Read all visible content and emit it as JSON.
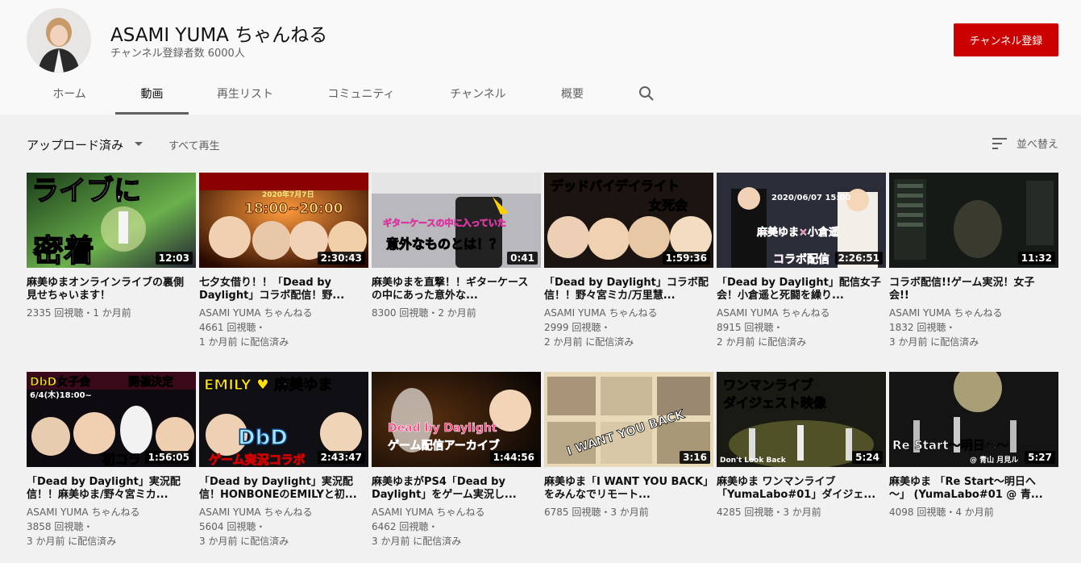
{
  "channel": {
    "name": "ASAMI YUMA ちゃんねる",
    "subscribers": "チャンネル登録者数 6000人",
    "subscribe_label": "チャンネル登録"
  },
  "tabs": [
    {
      "label": "ホーム",
      "active": false
    },
    {
      "label": "動画",
      "active": true
    },
    {
      "label": "再生リスト",
      "active": false
    },
    {
      "label": "コミュニティ",
      "active": false
    },
    {
      "label": "チャンネル",
      "active": false
    },
    {
      "label": "概要",
      "active": false
    }
  ],
  "toolbar": {
    "filter_label": "アップロード済み",
    "play_all": "すべて再生",
    "sort_label": "並べ替え"
  },
  "videos": [
    {
      "title": "麻美ゆまオンラインライブの裏側見せちゃいます！",
      "meta1": "2335 回視聴・1 か月前",
      "meta2": "",
      "meta3": "",
      "duration": "12:03",
      "thumb_text": [
        "ライブに",
        "密着"
      ]
    },
    {
      "title": "七夕女借り！！「Dead by Daylight」コラボ配信！野...",
      "meta1": "ASAMI YUMA ちゃんねる",
      "meta2": "4661 回視聴・",
      "meta3": "1 か月前 に配信済み",
      "duration": "2:30:43",
      "thumb_text": [
        "2020年7月7日",
        "18:00~20:00"
      ]
    },
    {
      "title": "麻美ゆまを直撃！！ギターケースの中にあった意外な...",
      "meta1": "8300 回視聴・2 か月前",
      "meta2": "",
      "meta3": "",
      "duration": "0:41",
      "thumb_text": [
        "ギターケースの中に入っていた",
        "意外なものとは！？"
      ]
    },
    {
      "title": "「Dead by Daylight」コラボ配信！！野々宮ミカ/万里慧...",
      "meta1": "ASAMI YUMA ちゃんねる",
      "meta2": "2999 回視聴・",
      "meta3": "2 か月前 に配信済み",
      "duration": "1:59:36",
      "thumb_text": [
        "デッドバイデイライト",
        "女死会"
      ]
    },
    {
      "title": "「Dead by Daylight」配信女子会！小倉遥と死闘を繰り...",
      "meta1": "ASAMI YUMA ちゃんねる",
      "meta2": "8915 回視聴・",
      "meta3": "2 か月前 に配信済み",
      "duration": "2:26:51",
      "thumb_text": [
        "2020/06/07 15:00",
        "麻美ゆま×小倉遥",
        "コラボ配信"
      ]
    },
    {
      "title": "コラボ配信!!ゲーム実況！女子会!!",
      "meta1": "ASAMI YUMA ちゃんねる",
      "meta2": "1832 回視聴・",
      "meta3": "3 か月前 に配信済み",
      "duration": "11:32",
      "thumb_text": []
    },
    {
      "title": "「Dead by Daylight」実況配信！！麻美ゆま/野々宮ミカ...",
      "meta1": "ASAMI YUMA ちゃんねる",
      "meta2": "3858 回視聴・",
      "meta3": "3 か月前 に配信済み",
      "duration": "1:56:05",
      "thumb_text": [
        "DbD女子会",
        "開催決定",
        "6/4(木)18:00~",
        "初コラ"
      ]
    },
    {
      "title": "「Dead by Daylight」実況配信！HONBONEのEMILYと初...",
      "meta1": "ASAMI YUMA ちゃんねる",
      "meta2": "5604 回視聴・",
      "meta3": "3 か月前 に配信済み",
      "duration": "2:43:47",
      "thumb_text": [
        "EMILY ♥ 麻美ゆま",
        "DbD",
        "ゲーム実況コラボ"
      ]
    },
    {
      "title": "麻美ゆまがPS4「Dead by Daylight」をゲーム実況し...",
      "meta1": "ASAMI YUMA ちゃんねる",
      "meta2": "6462 回視聴・",
      "meta3": "3 か月前 に配信済み",
      "duration": "1:44:56",
      "thumb_text": [
        "Dead by Daylight",
        "ゲーム配信アーカイブ"
      ]
    },
    {
      "title": "麻美ゆま「I WANT YOU BACK」をみんなでリモート...",
      "meta1": "6785 回視聴・3 か月前",
      "meta2": "",
      "meta3": "",
      "duration": "3:16",
      "thumb_text": [
        "I WANT YOU BACK"
      ]
    },
    {
      "title": "麻美ゆま ワンマンライブ「YumaLabo#01」ダイジェ...",
      "meta1": "4285 回視聴・3 か月前",
      "meta2": "",
      "meta3": "",
      "duration": "5:24",
      "thumb_text": [
        "ワンマンライブ",
        "ダイジェスト映像",
        "Don't Look Back"
      ]
    },
    {
      "title": "麻美ゆま 「Re Start～明日へ～」 (YumaLabo#01 @ 青...",
      "meta1": "4098 回視聴・4 か月前",
      "meta2": "",
      "meta3": "",
      "duration": "5:27",
      "thumb_text": [
        "Re Start～明日へ～",
        "@ 青山 月見ル"
      ]
    }
  ]
}
